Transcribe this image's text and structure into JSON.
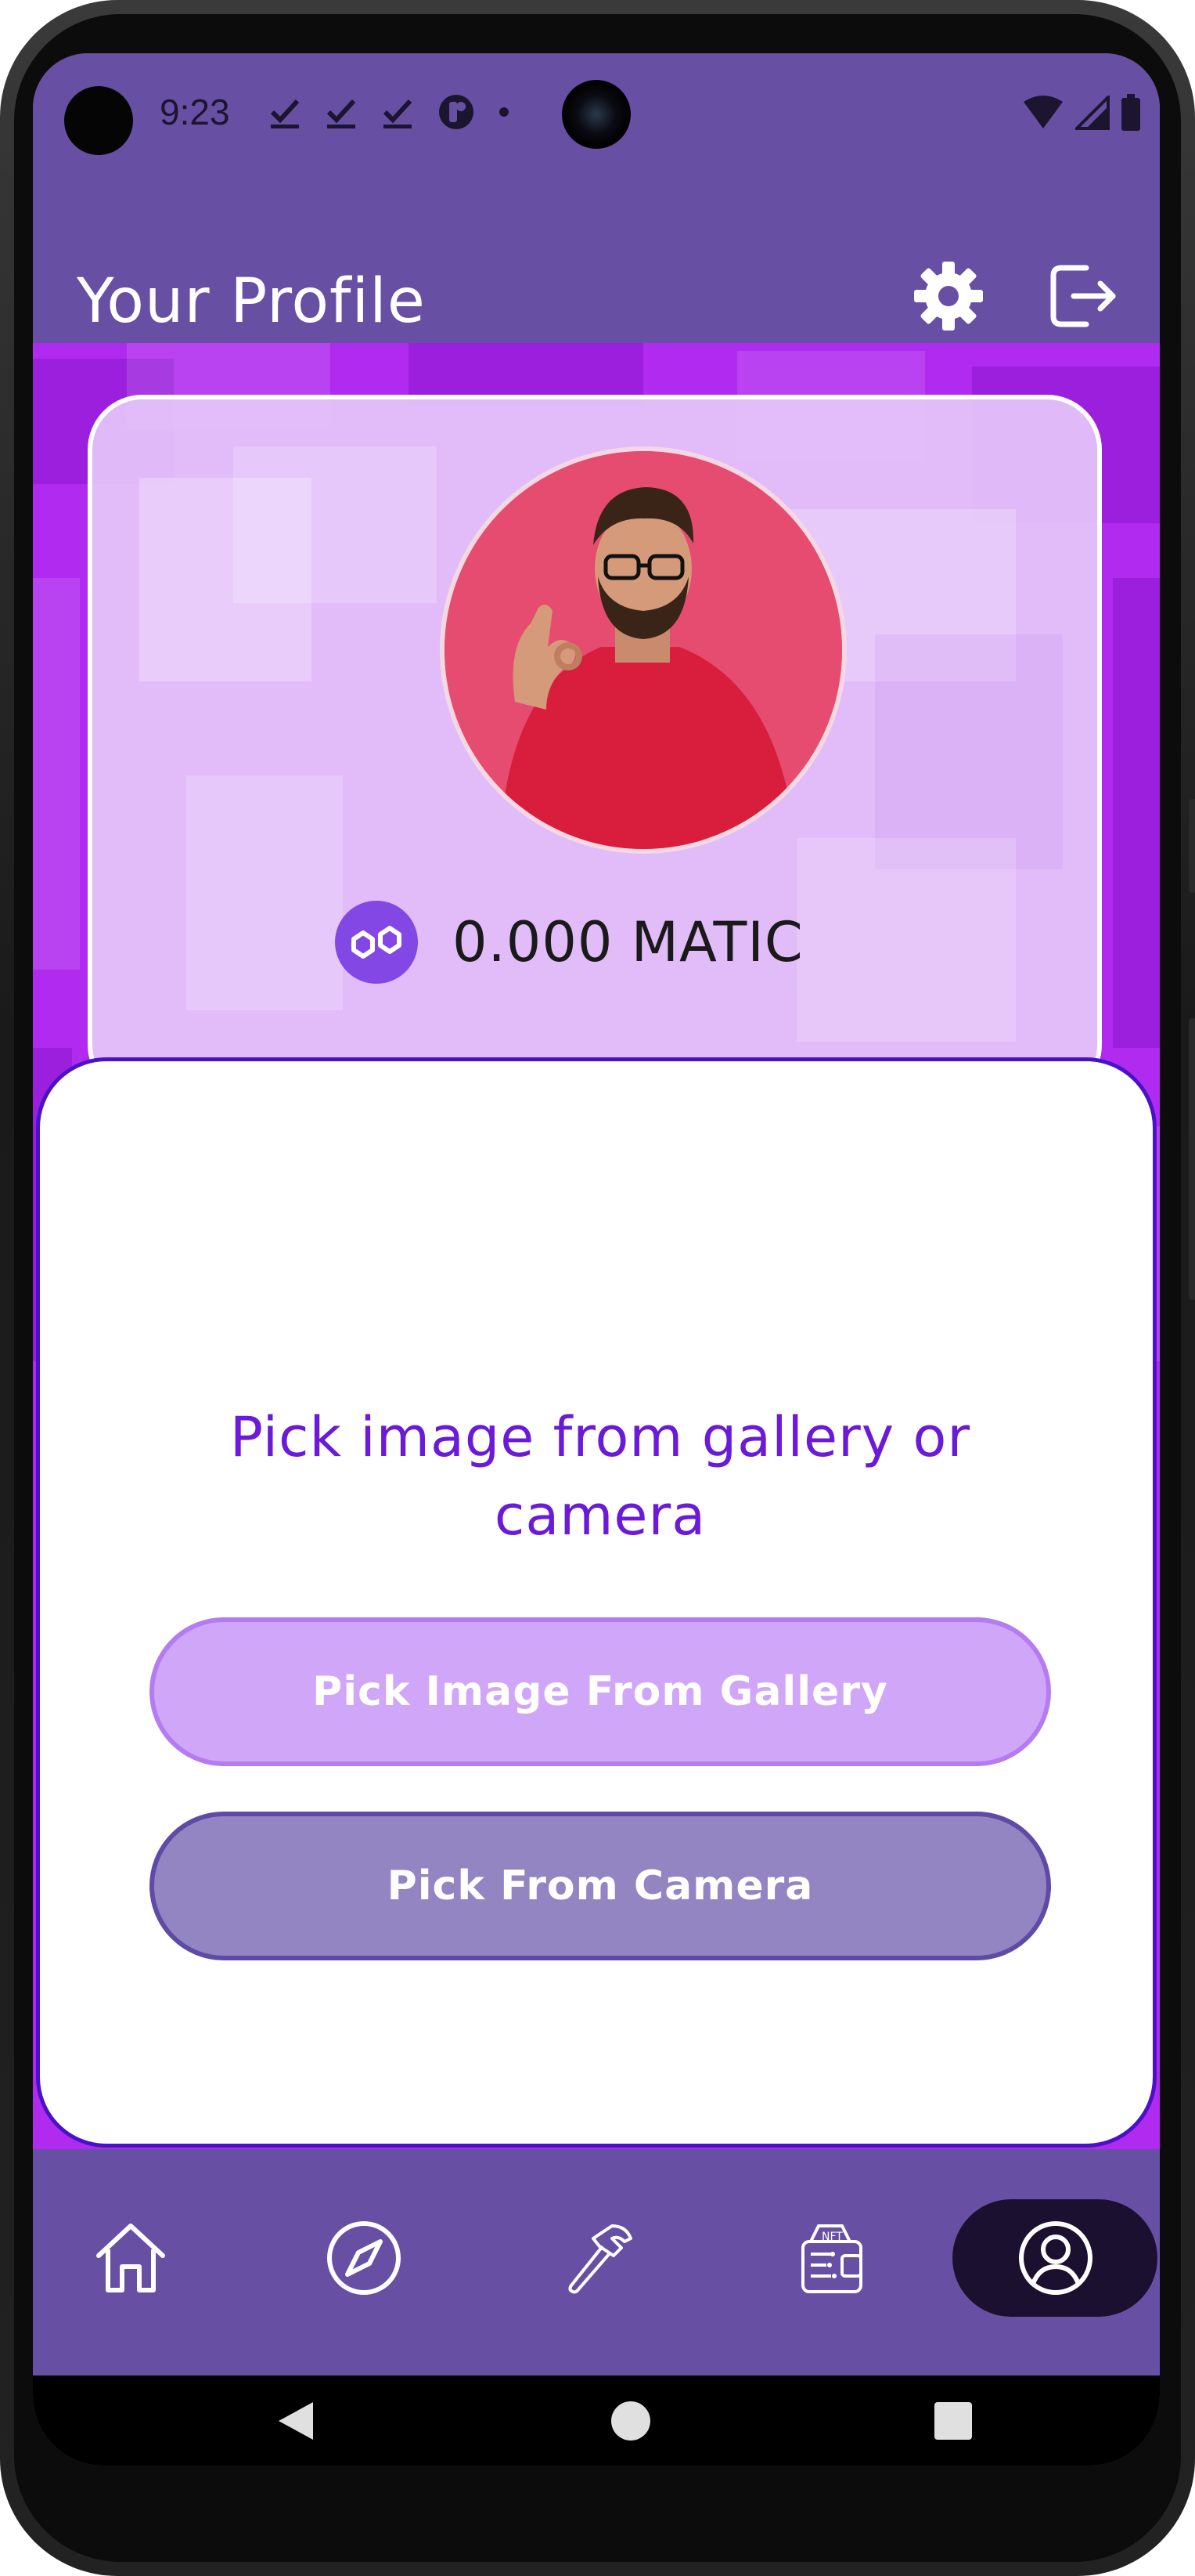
{
  "status_bar": {
    "time": "9:23"
  },
  "header": {
    "title": "Your Profile",
    "settings_icon": "gear-icon",
    "logout_icon": "logout-icon"
  },
  "profile": {
    "balance": "0.000 MATIC",
    "token_icon": "polygon-matic-icon"
  },
  "picker_sheet": {
    "title": "Pick image from gallery or camera",
    "gallery_button": "Pick Image From Gallery",
    "camera_button": "Pick From Camera"
  },
  "bottom_nav": {
    "items": [
      {
        "icon": "home-icon"
      },
      {
        "icon": "compass-icon"
      },
      {
        "icon": "hammer-icon"
      },
      {
        "icon": "nft-wallet-icon"
      },
      {
        "icon": "profile-icon",
        "active": true
      }
    ]
  },
  "colors": {
    "primary": "#6750A4",
    "content_bg": "#B02AF0",
    "sheet_border": "#4A12C8",
    "sheet_title": "#6A1AD8",
    "gallery_button": "#D0A6F8",
    "camera_button": "#9385C2",
    "active_nav": "#1C1030"
  }
}
